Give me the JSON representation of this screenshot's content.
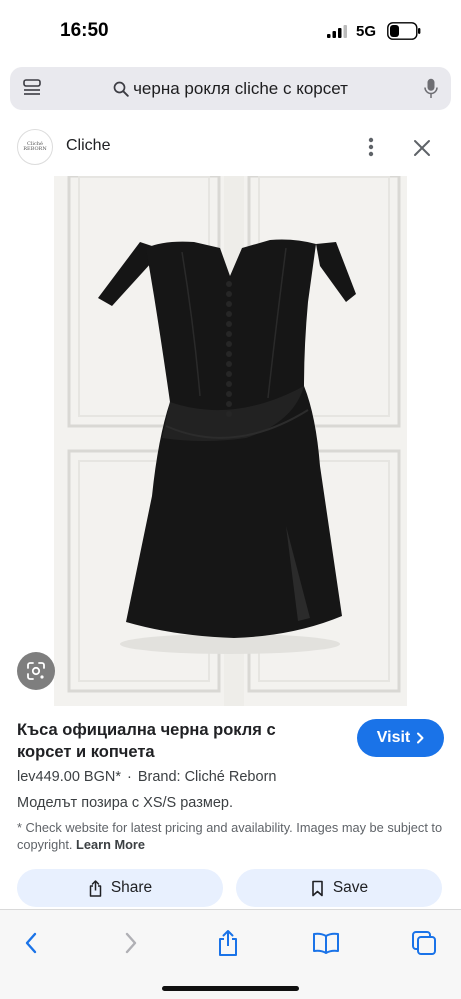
{
  "status_bar": {
    "time": "16:50",
    "network": "5G"
  },
  "search": {
    "query": "черна рокля cliche с корсет"
  },
  "source": {
    "name": "Cliche",
    "logo_text": "Cliché REBORN"
  },
  "product": {
    "title": "Къса официална черна рокля с корсет и копчета",
    "price": "lev449.00 BGN*",
    "separator": "·",
    "brand": "Brand: Cliché Reborn",
    "description": "Моделът позира с XS/S размер.",
    "disclaimer": "* Check website for latest pricing and availability. Images may be subject to copyright.",
    "learn_more": "Learn More"
  },
  "buttons": {
    "visit": "Visit",
    "share": "Share",
    "save": "Save"
  },
  "icons": {
    "tabs": "tabs-icon",
    "search": "search-icon",
    "mic": "mic-icon",
    "more": "more-vertical-icon",
    "close": "close-icon",
    "lens": "lens-icon",
    "share": "share-icon",
    "save": "bookmark-icon",
    "back": "back-icon",
    "forward": "forward-icon",
    "bookmarks": "bookmarks-icon",
    "pages": "pages-icon"
  },
  "colors": {
    "accent": "#1a73e8",
    "action_background": "#e8f0fe",
    "toolbar_icon": "#1a73e8",
    "toolbar_icon_disabled": "#b0b0b5"
  }
}
